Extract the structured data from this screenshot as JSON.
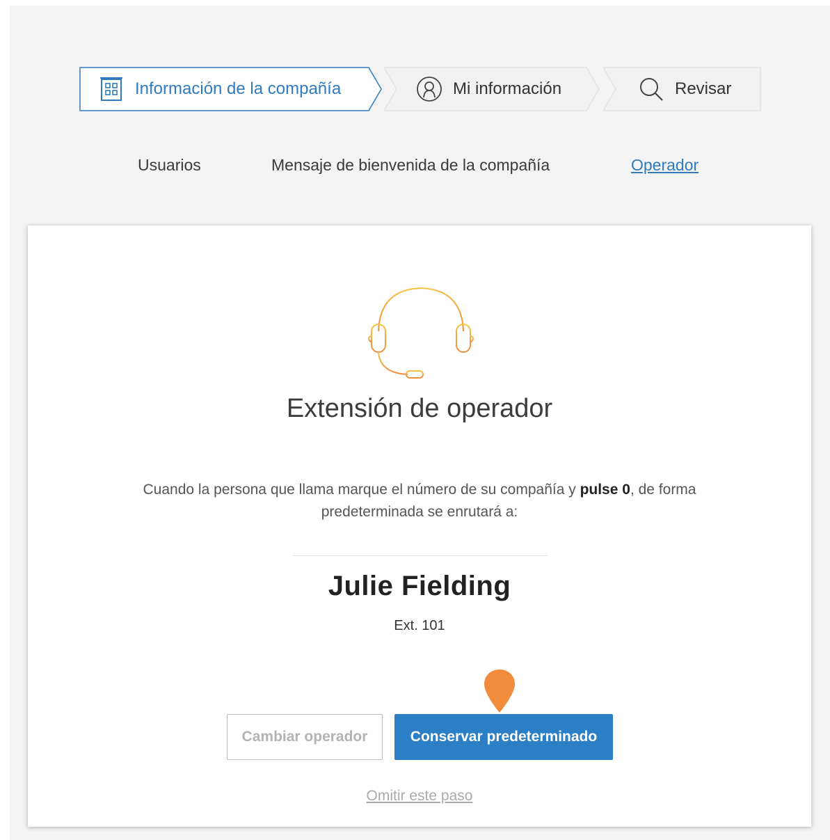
{
  "wizard": {
    "steps": [
      {
        "label": "Información de la compañía",
        "icon": "building-icon",
        "active": true
      },
      {
        "label": "Mi información",
        "icon": "user-icon",
        "active": false
      },
      {
        "label": "Revisar",
        "icon": "search-icon",
        "active": false
      }
    ]
  },
  "subnav": {
    "items": [
      {
        "label": "Usuarios",
        "active": false
      },
      {
        "label": "Mensaje de bienvenida de la compañía",
        "active": false
      },
      {
        "label": "Operador",
        "active": true
      }
    ]
  },
  "card": {
    "icon": "headset-icon",
    "title": "Extensión de operador",
    "description": {
      "before": "Cuando la persona que llama marque el número de su compañía y ",
      "bold": "pulse 0",
      "after": ", de forma predeterminada se enrutará a:"
    },
    "operator": {
      "name": "Julie Fielding",
      "extension": "Ext. 101"
    },
    "buttons": {
      "change_label": "Cambiar operador",
      "keep_label": "Conservar predeterminado"
    },
    "skip_label": "Omitir este paso"
  },
  "colors": {
    "accent": "#2c7fc5",
    "marker": "#f08c3b",
    "headset_gradient": [
      "#f5c342",
      "#f08c3b"
    ]
  }
}
